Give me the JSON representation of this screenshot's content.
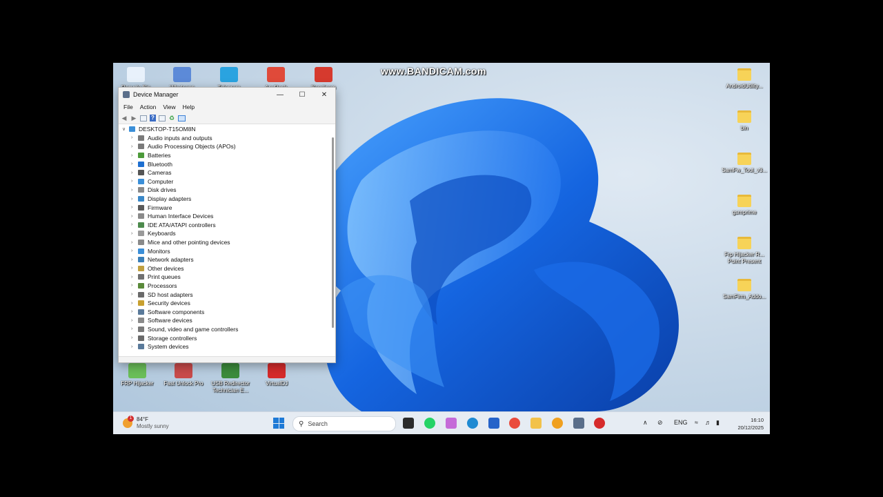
{
  "watermark": "www.BANDICAM.com",
  "desktop_icons_top": [
    {
      "label": "Recycle Bin",
      "color": "#e8f1fb",
      "icon": "recycle-bin-icon"
    },
    {
      "label": "Whatsapp",
      "color": "#5c8ad8",
      "icon": "shortcut-app-icon"
    },
    {
      "label": "Telegram",
      "color": "#2aa3e0",
      "icon": "telegram-icon"
    },
    {
      "label": "AnyDesk",
      "color": "#e04a3a",
      "icon": "anydesk-icon"
    },
    {
      "label": "Bandicam",
      "color": "#d63a2e",
      "icon": "bandicam-icon"
    }
  ],
  "desktop_icons_bottom": [
    {
      "label": "FRP Hijacker",
      "color": "#6bbf59",
      "icon": "frp-hijacker-icon"
    },
    {
      "label": "Fast Unlock Pro",
      "color": "#c94b4b",
      "icon": "fast-unlock-icon"
    },
    {
      "label": "USB Redirector Technician E...",
      "color": "#3c8c3c",
      "icon": "usb-redirector-icon"
    },
    {
      "label": "VirtualDJ",
      "color": "#d62b2b",
      "icon": "virtualdj-icon"
    }
  ],
  "desktop_icons_right": [
    {
      "label": "AndroidUtility..."
    },
    {
      "label": "bin"
    },
    {
      "label": "SamFw_Tool_v3..."
    },
    {
      "label": "gsmprime"
    },
    {
      "label": "Frp Hijacker R... Point Present"
    },
    {
      "label": "SamFirm_Addo..."
    }
  ],
  "window": {
    "title": "Device Manager",
    "menu": [
      "File",
      "Action",
      "View",
      "Help"
    ],
    "root": "DESKTOP-T15OM8N",
    "items": [
      {
        "label": "Audio inputs and outputs",
        "color": "#7a7a7a"
      },
      {
        "label": "Audio Processing Objects (APOs)",
        "color": "#7a7a7a"
      },
      {
        "label": "Batteries",
        "color": "#4c9a3a"
      },
      {
        "label": "Bluetooth",
        "color": "#1e6fd0"
      },
      {
        "label": "Cameras",
        "color": "#555555"
      },
      {
        "label": "Computer",
        "color": "#3b8fd8"
      },
      {
        "label": "Disk drives",
        "color": "#8a8a8a"
      },
      {
        "label": "Display adapters",
        "color": "#3a88c8"
      },
      {
        "label": "Firmware",
        "color": "#5a5a5a"
      },
      {
        "label": "Human Interface Devices",
        "color": "#8a8a8a"
      },
      {
        "label": "IDE ATA/ATAPI controllers",
        "color": "#4c8a4c"
      },
      {
        "label": "Keyboards",
        "color": "#9a9a9a"
      },
      {
        "label": "Mice and other pointing devices",
        "color": "#8a8a8a"
      },
      {
        "label": "Monitors",
        "color": "#3b8fd8"
      },
      {
        "label": "Network adapters",
        "color": "#3a7fb8"
      },
      {
        "label": "Other devices",
        "color": "#c0a040"
      },
      {
        "label": "Print queues",
        "color": "#707070"
      },
      {
        "label": "Processors",
        "color": "#5a8a3a"
      },
      {
        "label": "SD host adapters",
        "color": "#6a6a6a"
      },
      {
        "label": "Security devices",
        "color": "#c8a030"
      },
      {
        "label": "Software components",
        "color": "#5a7a9a"
      },
      {
        "label": "Software devices",
        "color": "#8a8a8a"
      },
      {
        "label": "Sound, video and game controllers",
        "color": "#7a7a7a"
      },
      {
        "label": "Storage controllers",
        "color": "#6a6a6a"
      },
      {
        "label": "System devices",
        "color": "#5a7a9a"
      }
    ]
  },
  "taskbar": {
    "weather_temp": "84°F",
    "weather_desc": "Mostly sunny",
    "weather_badge": "1",
    "search_placeholder": "Search",
    "apps": [
      {
        "icon": "terminal-icon",
        "color": "#2b2b2b"
      },
      {
        "icon": "whatsapp-icon",
        "color": "#25d366"
      },
      {
        "icon": "copilot-icon",
        "color": "#c56bd8"
      },
      {
        "icon": "edge-icon",
        "color": "#1f8ad2"
      },
      {
        "icon": "store-icon",
        "color": "#2563c9"
      },
      {
        "icon": "chrome-icon",
        "color": "#e94b3c"
      },
      {
        "icon": "file-explorer-icon",
        "color": "#f2c24a"
      },
      {
        "icon": "media-icon",
        "color": "#f0a020"
      },
      {
        "icon": "device-manager-icon",
        "color": "#5a6e8a"
      },
      {
        "icon": "bandicam-icon",
        "color": "#d62b2b"
      }
    ],
    "language": "ENG",
    "time": "16:10",
    "date": "20/12/2025"
  }
}
